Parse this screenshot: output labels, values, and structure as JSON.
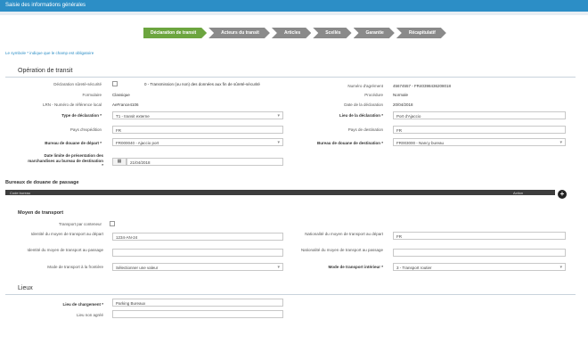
{
  "window": {
    "title": "Saisie des informations générales"
  },
  "wizard": {
    "steps": [
      "Déclaration de transit",
      "Acteurs du transit",
      "Articles",
      "Scellés",
      "Garantie",
      "Récapitulatif"
    ]
  },
  "note": "Le symbole * indique que le champ est obligatoire",
  "operation": {
    "title": "Opération de transit",
    "securite_label": "Déclaration sûreté-sécurité",
    "securite_value": "0 - Transmission (ou non) des données aux fin de sûreté-sécurité",
    "num_agrement_label": "Numéro d'agrément",
    "num_agrement_value": "45674557 - FR40398436208018",
    "formulaire_label": "Formulaire",
    "formulaire_value": "Classique",
    "procedure_label": "Procédure",
    "procedure_value": "Normale",
    "lrn_label": "LRN - Numéro de référence local",
    "lrn_value": "AeFrance4106",
    "date_decl_label": "Date de la déclaration",
    "date_decl_value": "20/04/2018",
    "type_decl_label": "Type de déclaration *",
    "type_decl_value": "T1 - transit externe",
    "lieu_decl_label": "Lieu de la déclaration *",
    "lieu_decl_value": "Port d'Ajaccio",
    "pays_exp_label": "Pays d'expédition",
    "pays_exp_value": "FR",
    "pays_dest_label": "Pays de destination",
    "pays_dest_value": "FR",
    "bureau_depart_label": "Bureau de douane de départ *",
    "bureau_depart_value": "FR000040 - Ajaccio port",
    "bureau_dest_label": "Bureau de douane de destination *",
    "bureau_dest_value": "FR003000 - Nancy bureau",
    "date_limite_label": "Date limite de présentation des marchandises au bureau de destination *",
    "date_limite_value": "21/04/2018"
  },
  "bureaux_passage": {
    "title": "Bureaux de douane de passage",
    "col_code": "Code bureau",
    "col_action": "Action",
    "add_label": "+"
  },
  "transport": {
    "title": "Moyen de transport",
    "conteneur_label": "Transport par conteneur",
    "id_depart_label": "Identité du moyen de transport au départ",
    "id_depart_value": "1234-AN-24",
    "nat_depart_label": "Nationalité du moyen de transport au départ",
    "nat_depart_value": "FR",
    "id_passage_label": "Identité du moyen de transport au passage",
    "id_passage_value": "",
    "nat_passage_label": "Nationalité du moyen de transport au passage",
    "nat_passage_value": "",
    "mode_frontiere_label": "Mode de transport à la frontière",
    "mode_frontiere_value": "Sélectionner une valeur",
    "mode_interieur_label": "Mode de transport intérieur *",
    "mode_interieur_value": "3 - Transport routier"
  },
  "lieux": {
    "title": "Lieux",
    "chargement_label": "Lieu de chargement *",
    "chargement_value": "Parking Bureaux",
    "non_agree_label": "Lieu non agréé",
    "non_agree_value": ""
  },
  "colors": {
    "accent": "#2c8ec6",
    "active_step": "#6ca53f",
    "inactive_step": "#8a8a8a"
  }
}
